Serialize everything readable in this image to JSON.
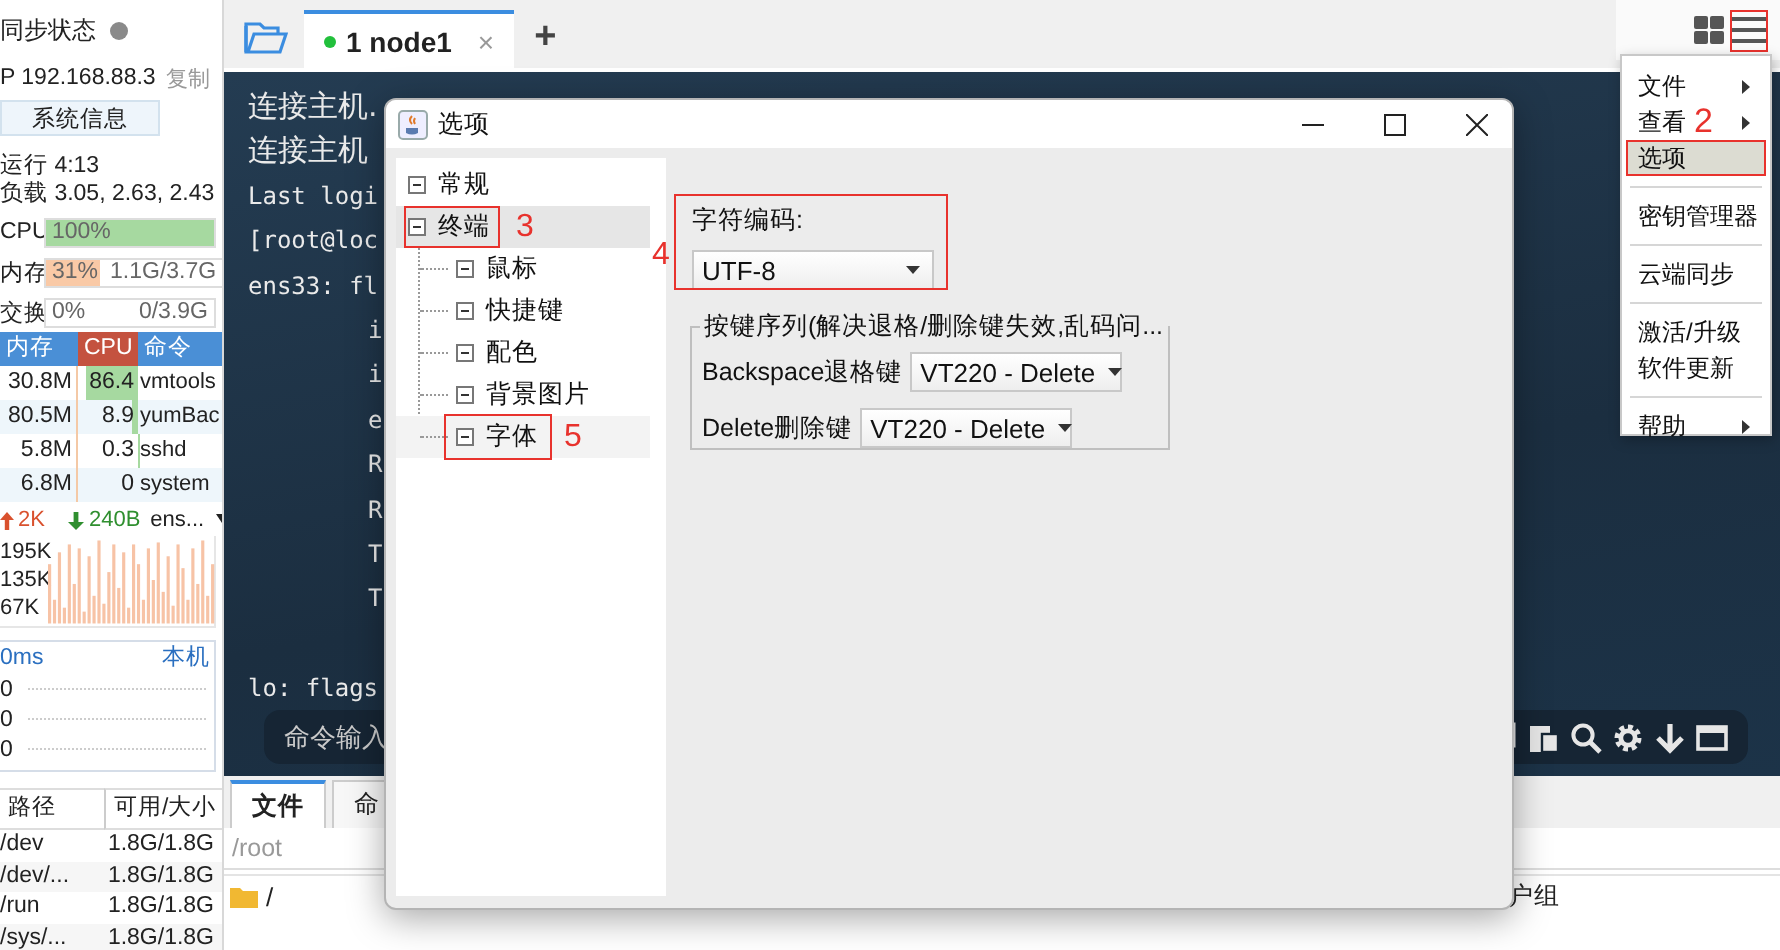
{
  "sidebar": {
    "sync": {
      "label": "同步状态",
      "online": false
    },
    "ip": {
      "text": "P 192.168.88.3",
      "copy": "复制"
    },
    "info_button": "系统信息",
    "uptime": "运行 4:13",
    "load": "负载 3.05, 2.63, 2.43",
    "meters": [
      {
        "name": "CPU",
        "reading": "100%",
        "level": 1.0,
        "color": "#a6d9a0"
      },
      {
        "name": "内存",
        "reading": "31%",
        "detail": "1.1G/3.7G",
        "level": 0.31,
        "color": "#f9c9a6"
      },
      {
        "name": "交换",
        "reading": "0%",
        "detail": "0/3.9G",
        "level": 0
      }
    ],
    "processes": {
      "columns": [
        "内存",
        "CPU",
        "命令"
      ],
      "rows": [
        {
          "mem": "30.8M",
          "cpu": "86.4",
          "cmd": "vmtools",
          "level": 0.864
        },
        {
          "mem": "80.5M",
          "cpu": "8.9",
          "cmd": "yumBac",
          "level": 0.089
        },
        {
          "mem": "5.8M",
          "cpu": "0.3",
          "cmd": "sshd",
          "level": 0.003
        },
        {
          "mem": "6.8M",
          "cpu": "0",
          "cmd": "system"
        }
      ]
    },
    "network": {
      "up": "2K",
      "down": "240B",
      "interface": "ens...",
      "scale": [
        "195K",
        "135K",
        "67K"
      ]
    },
    "ping": {
      "latency": "0ms",
      "host": "本机",
      "values": [
        "0",
        "0",
        "0"
      ]
    },
    "disks": {
      "columns": [
        "路径",
        "可用/大小"
      ],
      "rows": [
        [
          "/dev",
          "1.8G/1.8G"
        ],
        [
          "/dev/...",
          "1.8G/1.8G"
        ],
        [
          "/run",
          "1.8G/1.8G"
        ],
        [
          "/sys/...",
          "1.8G/1.8G"
        ]
      ]
    }
  },
  "main": {
    "tabs": [
      {
        "label": "1 node1",
        "selected": true,
        "connected": true,
        "close": "×"
      }
    ],
    "add_tab": "+",
    "menu_button": {
      "marked": true
    },
    "terminal": {
      "lines": [
        {
          "text": "连接主机.",
          "indent": false
        },
        {
          "text": "连接主机",
          "indent": false
        },
        {
          "text": "Last logi",
          "indent": false
        },
        {
          "text": "[root@loc",
          "indent": false
        },
        {
          "text": "ens33: fl",
          "indent": false
        },
        {
          "text": "i",
          "indent": true
        },
        {
          "text": "i",
          "indent": true
        },
        {
          "text": "e",
          "indent": true
        },
        {
          "text": "R",
          "indent": true
        },
        {
          "text": "R",
          "indent": true
        },
        {
          "text": "T",
          "indent": true
        },
        {
          "text": "T",
          "indent": true
        },
        {
          "text": "lo: flags",
          "indent": false
        }
      ],
      "command_placeholder": "命令输入"
    },
    "bottom": {
      "tabs": [
        {
          "label": "文件",
          "selected": true
        },
        {
          "label": "命",
          "selected": false
        }
      ],
      "path": "/root",
      "files": [
        {
          "name": "/"
        }
      ],
      "column_header": "户组"
    }
  },
  "menu": {
    "items": [
      {
        "kind": "submenu",
        "label": "文件",
        "selected": false,
        "marked": false
      },
      {
        "kind": "submenu",
        "label": "查看",
        "selected": false,
        "marked": false
      },
      {
        "kind": "item",
        "label": "选项",
        "selected": true,
        "marked": true,
        "note": "2"
      },
      {
        "kind": "separator"
      },
      {
        "kind": "item",
        "label": "密钥管理器",
        "selected": false,
        "marked": false
      },
      {
        "kind": "separator"
      },
      {
        "kind": "item",
        "label": "云端同步",
        "selected": false,
        "marked": false
      },
      {
        "kind": "separator"
      },
      {
        "kind": "item",
        "label": "激活/升级",
        "selected": false,
        "marked": false
      },
      {
        "kind": "item",
        "label": "软件更新",
        "selected": false,
        "marked": false
      },
      {
        "kind": "separator"
      },
      {
        "kind": "submenu",
        "label": "帮助",
        "selected": false,
        "marked": false
      }
    ]
  },
  "dialog": {
    "title": "选项",
    "tree": [
      {
        "label": "常规",
        "selected": false,
        "hovered": false,
        "marked": false
      },
      {
        "label": "终端",
        "selected": true,
        "hovered": false,
        "marked": true,
        "note": "3",
        "children": [
          {
            "label": "鼠标",
            "selected": false,
            "hovered": false,
            "marked": false
          },
          {
            "label": "快捷键",
            "selected": false,
            "hovered": false,
            "marked": false
          },
          {
            "label": "配色",
            "selected": false,
            "hovered": false,
            "marked": false
          },
          {
            "label": "背景图片",
            "selected": false,
            "hovered": false,
            "marked": false
          },
          {
            "label": "字体",
            "selected": false,
            "hovered": true,
            "marked": true,
            "note": "5"
          }
        ]
      }
    ],
    "encoding": {
      "label": "字符编码:",
      "value": "UTF-8",
      "marked": true,
      "note": "4"
    },
    "keys": {
      "legend": "按键序列(解决退格/删除键失效,乱码问...",
      "fields": [
        {
          "label": "Backspace退格键",
          "value": "VT220 - Delete"
        },
        {
          "label": "Delete删除键",
          "value": "VT220 - Delete"
        }
      ]
    }
  }
}
